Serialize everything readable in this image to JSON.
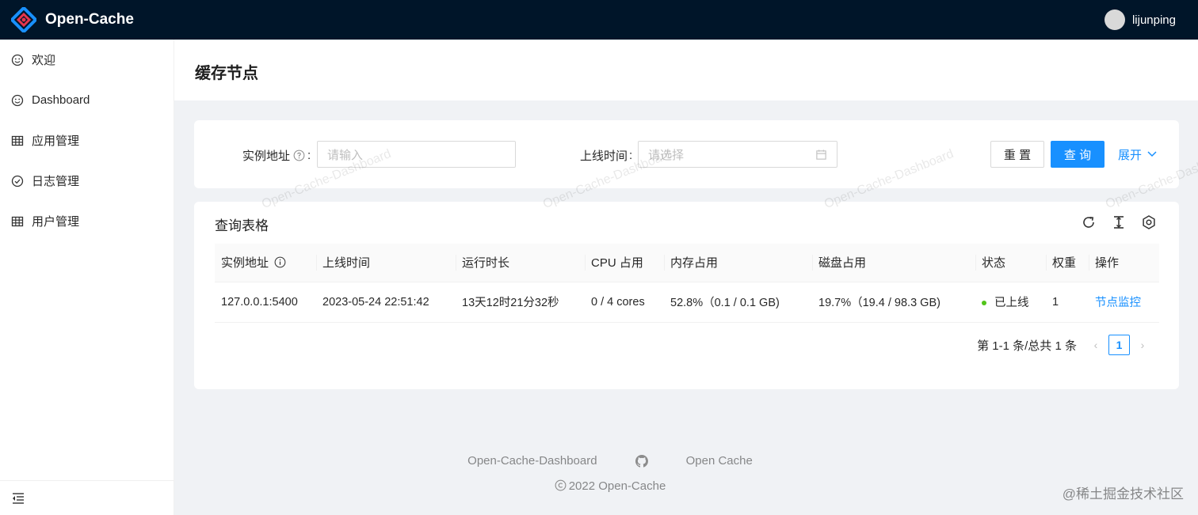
{
  "header": {
    "app_title": "Open-Cache",
    "username": "lijunping"
  },
  "sidebar": {
    "items": [
      {
        "label": "欢迎",
        "icon": "smile-icon"
      },
      {
        "label": "Dashboard",
        "icon": "smile-icon"
      },
      {
        "label": "应用管理",
        "icon": "table-icon"
      },
      {
        "label": "日志管理",
        "icon": "check-circle-icon"
      },
      {
        "label": "用户管理",
        "icon": "table-icon"
      }
    ],
    "collapse_icon": "menu-fold-icon"
  },
  "page": {
    "title": "缓存节点"
  },
  "search": {
    "address_label": "实例地址",
    "address_colon": ":",
    "address_placeholder": "请输入",
    "time_label": "上线时间",
    "time_colon": ":",
    "time_placeholder": "请选择",
    "reset_label": "重 置",
    "query_label": "查 询",
    "expand_label": "展开"
  },
  "table": {
    "title": "查询表格",
    "columns": [
      "实例地址",
      "上线时间",
      "运行时长",
      "CPU 占用",
      "内存占用",
      "磁盘占用",
      "状态",
      "权重",
      "操作"
    ],
    "rows": [
      {
        "address": "127.0.0.1:5400",
        "online_time": "2023-05-24 22:51:42",
        "uptime": "13天12时21分32秒",
        "cpu": "0 / 4 cores",
        "memory": "52.8%（0.1 / 0.1 GB)",
        "disk": "19.7%（19.4 / 98.3 GB)",
        "status": "已上线",
        "weight": "1",
        "action": "节点监控"
      }
    ]
  },
  "pagination": {
    "total_text": "第 1-1 条/总共 1 条",
    "current": "1"
  },
  "watermark": "Open-Cache-Dashboard",
  "footer": {
    "link1": "Open-Cache-Dashboard",
    "link2": "Open Cache",
    "copyright": "2022 Open-Cache",
    "juejin": "@稀土掘金技术社区"
  },
  "colors": {
    "header_bg": "#001529",
    "primary": "#1890ff",
    "status_online": "#52c41a"
  }
}
